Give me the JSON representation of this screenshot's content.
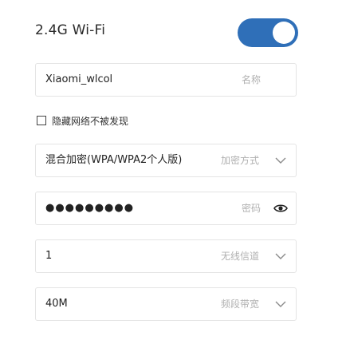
{
  "header": {
    "title": "2.4G Wi-Fi",
    "toggle_on": true
  },
  "ssid": {
    "value": "Xiaomi_wlcol",
    "label": "名称"
  },
  "hide_network": {
    "label": "隐藏网络不被发现",
    "checked": false
  },
  "encryption": {
    "value": "混合加密(WPA/WPA2个人版)",
    "label": "加密方式"
  },
  "password": {
    "value": "●●●●●●●●●",
    "label": "密码"
  },
  "channel": {
    "value": "1",
    "label": "无线信道"
  },
  "bandwidth": {
    "value": "40M",
    "label": "频段带宽"
  },
  "colors": {
    "accent": "#2f6fb8",
    "hint": "#b0b0b0"
  }
}
